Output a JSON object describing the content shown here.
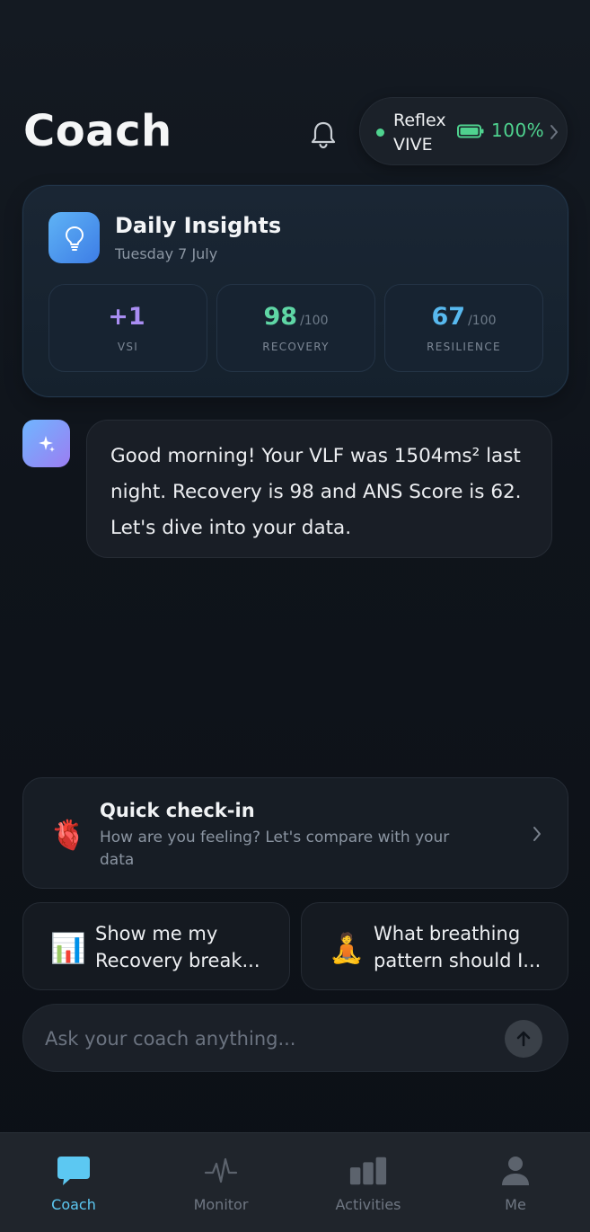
{
  "header": {
    "title": "Coach",
    "device": {
      "name": "Reflex VIVE",
      "battery": "100%"
    }
  },
  "insights": {
    "title": "Daily Insights",
    "date": "Tuesday 7 July",
    "metrics": [
      {
        "value": "+1",
        "max": "",
        "label": "VSI",
        "color": "#a98df2"
      },
      {
        "value": "98",
        "max": "/100",
        "label": "RECOVERY",
        "color": "#5fd6a5"
      },
      {
        "value": "67",
        "max": "/100",
        "label": "RESILIENCE",
        "color": "#58b9ef"
      }
    ]
  },
  "chat": {
    "message": "Good morning! Your VLF was 1504ms² last night. Recovery is 98 and ANS Score is 62. Let's dive into your data."
  },
  "checkin": {
    "title": "Quick check-in",
    "subtitle": "How are you feeling? Let's compare with your data"
  },
  "suggestions": [
    {
      "emoji": "📊",
      "text": "Show me my Recovery break..."
    },
    {
      "emoji": "🧘",
      "text": "What breathing pattern should I..."
    }
  ],
  "input": {
    "placeholder": "Ask your coach anything..."
  },
  "nav": {
    "items": [
      {
        "label": "Coach",
        "icon": "chat-bubble-icon",
        "active": true
      },
      {
        "label": "Monitor",
        "icon": "pulse-icon",
        "active": false
      },
      {
        "label": "Activities",
        "icon": "bar-chart-icon",
        "active": false
      },
      {
        "label": "Me",
        "icon": "person-icon",
        "active": false
      }
    ]
  },
  "colors": {
    "accent": "#5cc8f2",
    "battery_green": "#4fd38f",
    "background": "#0f141b"
  }
}
